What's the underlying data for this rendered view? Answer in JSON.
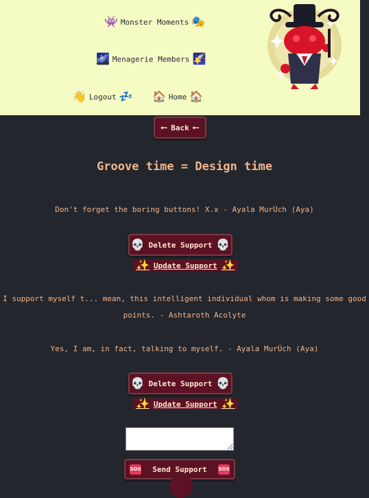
{
  "nav": {
    "monster_moments": {
      "label": "Monster Moments",
      "icon_left": "👾",
      "icon_right": "🎭"
    },
    "menagerie_members": {
      "label": "Menagerie Members",
      "icon_left": "🌌",
      "icon_right": "🌠"
    },
    "logout": {
      "label": "Logout",
      "icon_left": "👋",
      "icon_right": "💤"
    },
    "home": {
      "label": "Home",
      "icon_left": "🏠",
      "icon_right": "🏠"
    }
  },
  "back_button": {
    "label": "Back",
    "arrow": "⟵"
  },
  "page_title": "Groove time = Design time",
  "posts": [
    {
      "text": "Don't forget the boring buttons! X.x - Ayala MurÚch (Aya)",
      "delete_label": "Delete Support",
      "update_label": "Update Support"
    },
    {
      "text": "I support myself t... mean, this intelligent individual whom is making some good points. - Ashtaroth Acolyte",
      "delete_label": "Delete Support",
      "update_label": "Update Support"
    },
    {
      "text": "Yes, I am, in fact, talking to myself. - Ayala MurÚch (Aya)",
      "delete_label": "Delete Support",
      "update_label": "Update Support"
    }
  ],
  "icons": {
    "skull": "💀",
    "sparkle": "✨",
    "sos": "SOS"
  },
  "reply": {
    "value": ""
  },
  "send_button": {
    "label": "Send Support"
  },
  "colors": {
    "background": "#23262d",
    "topbar": "#f4fcc4",
    "button": "#5c1222",
    "accent_text": "#f2b58c"
  }
}
